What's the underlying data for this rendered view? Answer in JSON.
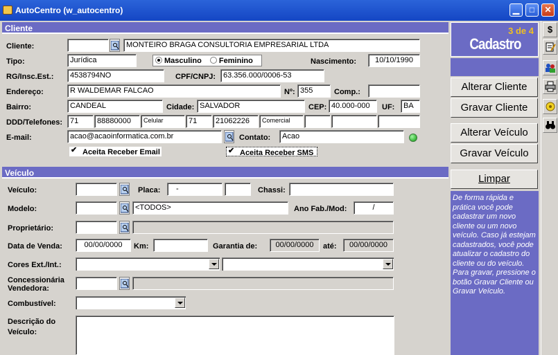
{
  "window": {
    "title": "AutoCentro (w_autocentro)"
  },
  "cliente": {
    "section_title": "Cliente",
    "cliente_label": "Cliente:",
    "cliente_code": "",
    "cliente_name": "MONTEIRO BRAGA CONSULTORIA EMPRESARIAL LTDA",
    "tipo_label": "Tipo:",
    "tipo_value": "Jurídica",
    "sexo_masculino": "Masculino",
    "sexo_feminino": "Feminino",
    "nascimento_label": "Nascimento:",
    "nascimento_value": "10/10/1990",
    "rg_label": "RG/Insc.Est.:",
    "rg_value": "4538794NO",
    "cpf_label": "CPF/CNPJ:",
    "cpf_value": "63.356.000/0006-53",
    "endereco_label": "Endereço:",
    "endereco_value": "R WALDEMAR FALCAO",
    "numero_label": "Nº:",
    "numero_value": "355",
    "comp_label": "Comp.:",
    "comp_value": "",
    "bairro_label": "Bairro:",
    "bairro_value": "CANDEAL",
    "cidade_label": "Cidade:",
    "cidade_value": "SALVADOR",
    "cep_label": "CEP:",
    "cep_value": "40.000-000",
    "uf_label": "UF:",
    "uf_value": "BA",
    "telefones_label": "DDD/Telefones:",
    "phones": [
      {
        "ddd": "71",
        "number": "88880000",
        "type": "Celular"
      },
      {
        "ddd": "71",
        "number": "21062226",
        "type": "Comercial"
      }
    ],
    "email_label": "E-mail:",
    "email_value": "acao@acaoinformatica.com.br",
    "contato_label": "Contato:",
    "contato_value": "Acao",
    "aceita_email": "Aceita Receber Email",
    "aceita_sms": "Aceita Receber SMS"
  },
  "veiculo": {
    "section_title": "Veículo",
    "veiculo_label": "Veículo:",
    "placa_label": "Placa:",
    "placa_value": "-",
    "chassi_label": "Chassi:",
    "modelo_label": "Modelo:",
    "modelo_value": "<TODOS>",
    "ano_label": "Ano Fab./Mod:",
    "ano_value": "/",
    "proprietario_label": "Proprietário:",
    "data_venda_label": "Data de Venda:",
    "data_venda_value": "00/00/0000",
    "km_label": "Km:",
    "garantia_label": "Garantia de:",
    "garantia_de_value": "00/00/0000",
    "ate_label": "até:",
    "garantia_ate_value": "00/00/0000",
    "cores_label": "Cores Ext./Int.:",
    "concessionaria_label_1": "Concessionária",
    "concessionaria_label_2": "Vendedora:",
    "combustivel_label": "Combustível:",
    "descricao_label_1": "Descrição do",
    "descricao_label_2": "Veículo:"
  },
  "sidebar": {
    "step": "3 de 4",
    "title": "Cadastro",
    "alterar_cliente": "Alterar Cliente",
    "gravar_cliente": "Gravar Cliente",
    "alterar_veiculo": "Alterar Veículo",
    "gravar_veiculo": "Gravar Veículo",
    "limpar": "Limpar",
    "help_text": "De forma rápida e prática você pode cadastrar um novo cliente ou um novo veículo. Caso já estejam cadastrados, você pode atualizar o cadastro do cliente ou do veículo. Para gravar, pressione o botão Gravar Cliente ou Gravar Veículo."
  },
  "toolbar": {
    "dollar": "$"
  },
  "colors": {
    "title_bar": "#1446c4",
    "section": "#6b6bc4",
    "step": "#f0c020"
  }
}
